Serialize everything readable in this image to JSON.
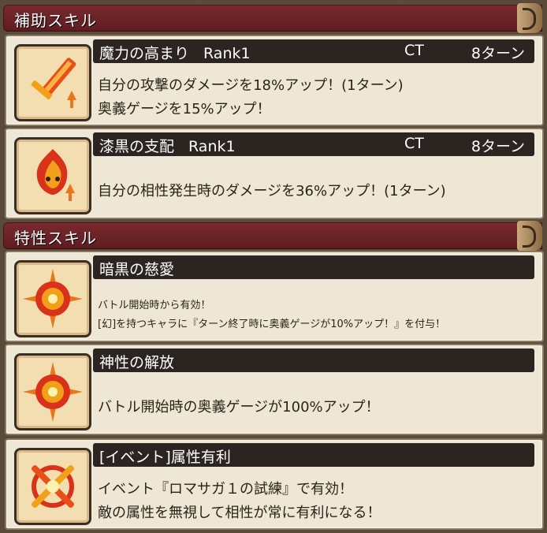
{
  "sections": [
    {
      "title": "補助スキル"
    },
    {
      "title": "特性スキル"
    }
  ],
  "skills": [
    {
      "name": "魔力の高まり",
      "rank": "Rank1",
      "ct_label": "CT",
      "ct_value": "8ターン",
      "lines": [
        "自分の攻撃のダメージを18%アップ！(1ターン)",
        "奥義ゲージを15%アップ！"
      ],
      "icon": "sword-icon"
    },
    {
      "name": "漆黒の支配",
      "rank": "Rank1",
      "ct_label": "CT",
      "ct_value": "8ターン",
      "lines": [
        "自分の相性発生時のダメージを36%アップ！(1ターン)"
      ],
      "icon": "dark-flame-icon"
    },
    {
      "name": "暗黒の慈愛",
      "lines": [
        "バトル開始時から有効！",
        "[幻]を持つキャラに『ターン終了時に奥義ゲージが10%アップ！』を付与！"
      ],
      "icon": "sun-burst-icon"
    },
    {
      "name": "神性の解放",
      "lines": [
        "バトル開始時の奥義ゲージが100%アップ！"
      ],
      "icon": "sun-burst-icon"
    },
    {
      "name": "[イベント]属性有利",
      "lines": [
        "イベント『ロマサガ１の試練』で有効！",
        "敵の属性を無視して相性が常に有利になる！"
      ],
      "icon": "crossed-attribute-icon"
    }
  ],
  "colors": {
    "header_bg": "#6a2428",
    "card_bg": "#efe7d6",
    "namebar_bg": "#2b2420",
    "icon_orange": "#e8761a",
    "icon_red": "#c8321a"
  }
}
